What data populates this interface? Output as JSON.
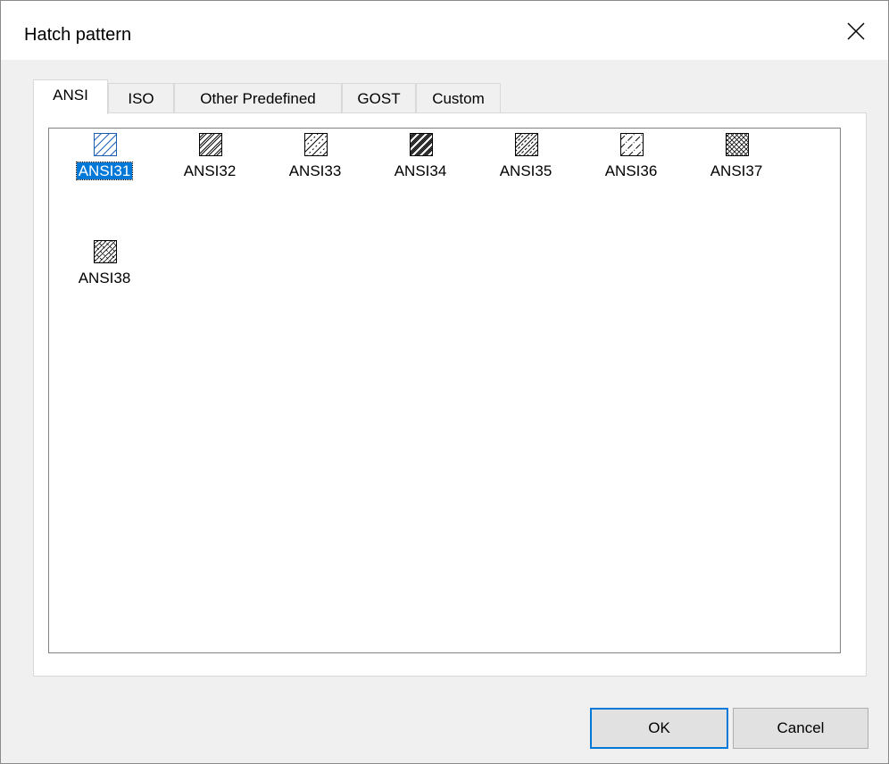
{
  "window": {
    "title": "Hatch pattern"
  },
  "tabs": [
    {
      "label": "ANSI",
      "active": true
    },
    {
      "label": "ISO",
      "active": false
    },
    {
      "label": "Other Predefined",
      "active": false
    },
    {
      "label": "GOST",
      "active": false
    },
    {
      "label": "Custom",
      "active": false
    }
  ],
  "patterns": [
    {
      "name": "ANSI31",
      "selected": true,
      "icon": "ansi31-pattern-icon"
    },
    {
      "name": "ANSI32",
      "selected": false,
      "icon": "ansi32-pattern-icon"
    },
    {
      "name": "ANSI33",
      "selected": false,
      "icon": "ansi33-pattern-icon"
    },
    {
      "name": "ANSI34",
      "selected": false,
      "icon": "ansi34-pattern-icon"
    },
    {
      "name": "ANSI35",
      "selected": false,
      "icon": "ansi35-pattern-icon"
    },
    {
      "name": "ANSI36",
      "selected": false,
      "icon": "ansi36-pattern-icon"
    },
    {
      "name": "ANSI37",
      "selected": false,
      "icon": "ansi37-pattern-icon"
    },
    {
      "name": "ANSI38",
      "selected": false,
      "icon": "ansi38-pattern-icon"
    }
  ],
  "buttons": {
    "ok_label": "OK",
    "cancel_label": "Cancel"
  },
  "colors": {
    "selection": "#0078d7",
    "dialog_bg": "#f0f0f0",
    "default_button_border": "#0078d7"
  }
}
